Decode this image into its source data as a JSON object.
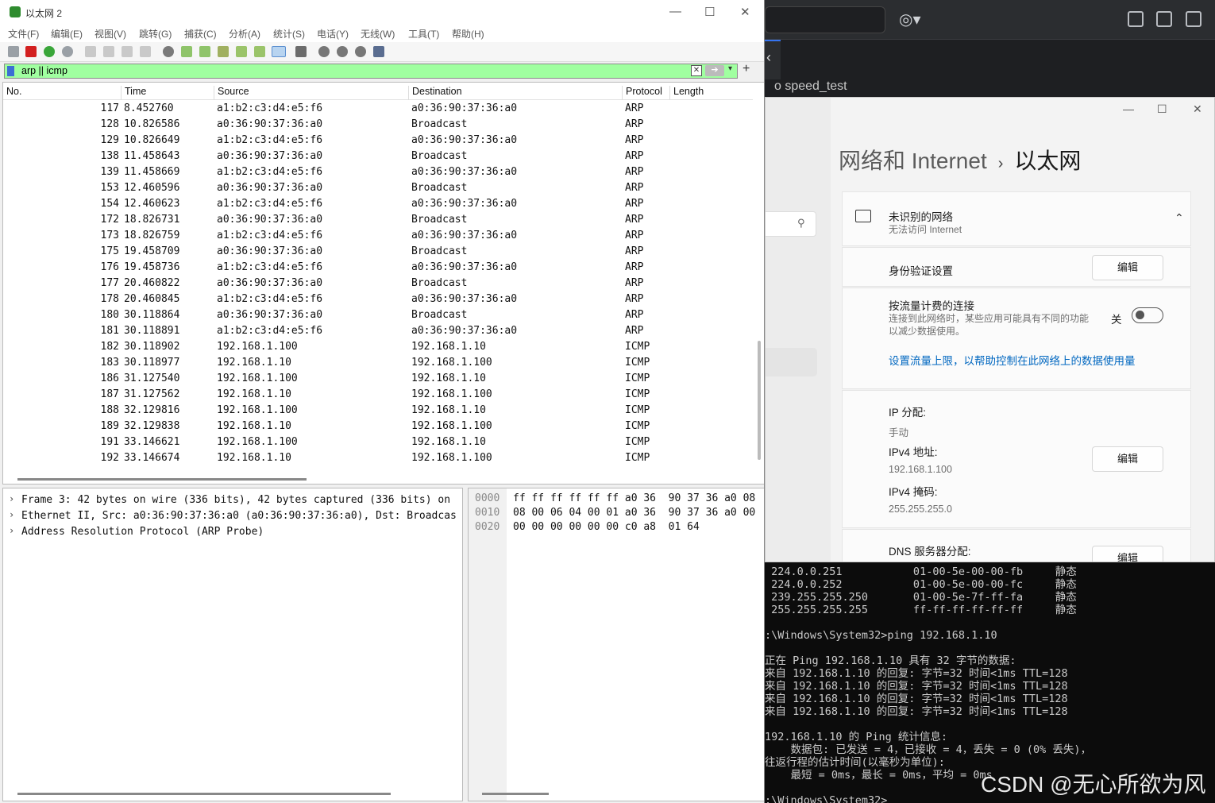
{
  "wireshark": {
    "window_title": "以太网 2",
    "menu": [
      "文件(F)",
      "编辑(E)",
      "视图(V)",
      "跳转(G)",
      "捕获(C)",
      "分析(A)",
      "统计(S)",
      "电话(Y)",
      "无线(W)",
      "工具(T)",
      "帮助(H)"
    ],
    "filter": "arp || icmp",
    "columns": [
      "No.",
      "Time",
      "Source",
      "Destination",
      "Protocol",
      "Length"
    ],
    "rows": [
      {
        "no": "117",
        "time": "8.452760",
        "src": "a1:b2:c3:d4:e5:f6",
        "dst": "a0:36:90:37:36:a0",
        "proto": "ARP"
      },
      {
        "no": "128",
        "time": "10.826586",
        "src": "a0:36:90:37:36:a0",
        "dst": "Broadcast",
        "proto": "ARP"
      },
      {
        "no": "129",
        "time": "10.826649",
        "src": "a1:b2:c3:d4:e5:f6",
        "dst": "a0:36:90:37:36:a0",
        "proto": "ARP"
      },
      {
        "no": "138",
        "time": "11.458643",
        "src": "a0:36:90:37:36:a0",
        "dst": "Broadcast",
        "proto": "ARP"
      },
      {
        "no": "139",
        "time": "11.458669",
        "src": "a1:b2:c3:d4:e5:f6",
        "dst": "a0:36:90:37:36:a0",
        "proto": "ARP"
      },
      {
        "no": "153",
        "time": "12.460596",
        "src": "a0:36:90:37:36:a0",
        "dst": "Broadcast",
        "proto": "ARP"
      },
      {
        "no": "154",
        "time": "12.460623",
        "src": "a1:b2:c3:d4:e5:f6",
        "dst": "a0:36:90:37:36:a0",
        "proto": "ARP"
      },
      {
        "no": "172",
        "time": "18.826731",
        "src": "a0:36:90:37:36:a0",
        "dst": "Broadcast",
        "proto": "ARP"
      },
      {
        "no": "173",
        "time": "18.826759",
        "src": "a1:b2:c3:d4:e5:f6",
        "dst": "a0:36:90:37:36:a0",
        "proto": "ARP"
      },
      {
        "no": "175",
        "time": "19.458709",
        "src": "a0:36:90:37:36:a0",
        "dst": "Broadcast",
        "proto": "ARP"
      },
      {
        "no": "176",
        "time": "19.458736",
        "src": "a1:b2:c3:d4:e5:f6",
        "dst": "a0:36:90:37:36:a0",
        "proto": "ARP"
      },
      {
        "no": "177",
        "time": "20.460822",
        "src": "a0:36:90:37:36:a0",
        "dst": "Broadcast",
        "proto": "ARP"
      },
      {
        "no": "178",
        "time": "20.460845",
        "src": "a1:b2:c3:d4:e5:f6",
        "dst": "a0:36:90:37:36:a0",
        "proto": "ARP"
      },
      {
        "no": "180",
        "time": "30.118864",
        "src": "a0:36:90:37:36:a0",
        "dst": "Broadcast",
        "proto": "ARP"
      },
      {
        "no": "181",
        "time": "30.118891",
        "src": "a1:b2:c3:d4:e5:f6",
        "dst": "a0:36:90:37:36:a0",
        "proto": "ARP"
      },
      {
        "no": "182",
        "time": "30.118902",
        "src": "192.168.1.100",
        "dst": "192.168.1.10",
        "proto": "ICMP"
      },
      {
        "no": "183",
        "time": "30.118977",
        "src": "192.168.1.10",
        "dst": "192.168.1.100",
        "proto": "ICMP"
      },
      {
        "no": "186",
        "time": "31.127540",
        "src": "192.168.1.100",
        "dst": "192.168.1.10",
        "proto": "ICMP"
      },
      {
        "no": "187",
        "time": "31.127562",
        "src": "192.168.1.10",
        "dst": "192.168.1.100",
        "proto": "ICMP"
      },
      {
        "no": "188",
        "time": "32.129816",
        "src": "192.168.1.100",
        "dst": "192.168.1.10",
        "proto": "ICMP"
      },
      {
        "no": "189",
        "time": "32.129838",
        "src": "192.168.1.10",
        "dst": "192.168.1.100",
        "proto": "ICMP"
      },
      {
        "no": "191",
        "time": "33.146621",
        "src": "192.168.1.100",
        "dst": "192.168.1.10",
        "proto": "ICMP"
      },
      {
        "no": "192",
        "time": "33.146674",
        "src": "192.168.1.10",
        "dst": "192.168.1.100",
        "proto": "ICMP"
      }
    ],
    "details": [
      "Frame 3: 42 bytes on wire (336 bits), 42 bytes captured (336 bits) on",
      "Ethernet II, Src: a0:36:90:37:36:a0 (a0:36:90:37:36:a0), Dst: Broadcas",
      "Address Resolution Protocol (ARP Probe)"
    ],
    "bytes": [
      {
        "off": "0000",
        "hex": "ff ff ff ff ff ff a0 36  90 37 36 a0 08"
      },
      {
        "off": "0010",
        "hex": "08 00 06 04 00 01 a0 36  90 37 36 a0 00"
      },
      {
        "off": "0020",
        "hex": "00 00 00 00 00 00 c0 a8  01 64"
      }
    ]
  },
  "background_app": {
    "subtitle": "o speed_test"
  },
  "settings": {
    "breadcrumb_parent": "网络和 Internet",
    "breadcrumb_current": "以太网",
    "network_name": "未识别的网络",
    "network_status": "无法访问 Internet",
    "auth_label": "身份验证设置",
    "edit_label": "编辑",
    "metered_title": "按流量计费的连接",
    "metered_desc1": "连接到此网络时，某些应用可能具有不同的功能",
    "metered_desc2": "以减少数据使用。",
    "metered_state": "关",
    "data_limit_link": "设置流量上限，以帮助控制在此网络上的数据使用量",
    "ip_assign_label": "IP 分配:",
    "ip_assign_value": "手动",
    "ipv4_label": "IPv4 地址:",
    "ipv4_value": "192.168.1.100",
    "mask_label": "IPv4 掩码:",
    "mask_value": "255.255.255.0",
    "dns_label": "DNS 服务器分配:"
  },
  "cmd": {
    "lines": [
      " 224.0.0.251           01-00-5e-00-00-fb     静态",
      " 224.0.0.252           01-00-5e-00-00-fc     静态",
      " 239.255.255.250       01-00-5e-7f-ff-fa     静态",
      " 255.255.255.255       ff-ff-ff-ff-ff-ff     静态",
      "",
      ":\\Windows\\System32>ping 192.168.1.10",
      "",
      "正在 Ping 192.168.1.10 具有 32 字节的数据:",
      "来自 192.168.1.10 的回复: 字节=32 时间<1ms TTL=128",
      "来自 192.168.1.10 的回复: 字节=32 时间<1ms TTL=128",
      "来自 192.168.1.10 的回复: 字节=32 时间<1ms TTL=128",
      "来自 192.168.1.10 的回复: 字节=32 时间<1ms TTL=128",
      "",
      "192.168.1.10 的 Ping 统计信息:",
      "    数据包: 已发送 = 4，已接收 = 4，丢失 = 0 (0% 丢失)，",
      "往返行程的估计时间(以毫秒为单位):",
      "    最短 = 0ms，最长 = 0ms，平均 = 0ms",
      "",
      ":\\Windows\\System32>"
    ]
  },
  "watermark": "CSDN @无心所欲为风",
  "colors": {
    "filter_bg": "#a0ffa0",
    "link": "#0067c0",
    "terminal_bg": "#0c0c0c"
  }
}
